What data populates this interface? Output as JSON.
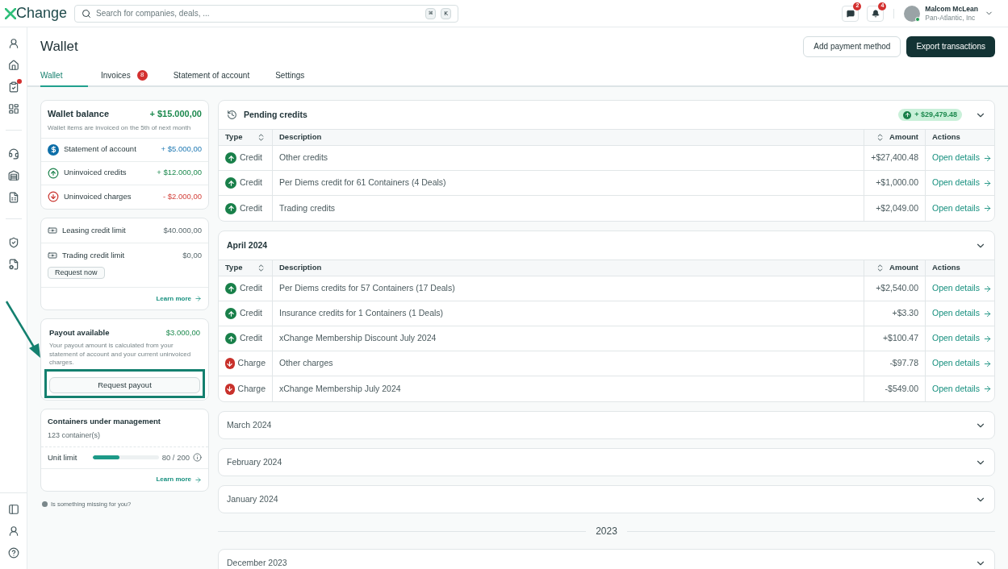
{
  "topbar": {
    "logo": "Change",
    "search": {
      "placeholder": "Search for companies, deals, ...",
      "keys": [
        "⌘",
        "K"
      ]
    },
    "messages_count": "2",
    "notifications_count": "4",
    "user": {
      "name": "Malcom McLean",
      "company": "Pan-Atlantic, Inc",
      "online": true
    }
  },
  "sidebar": {
    "groups": [
      [
        {
          "dot": false
        },
        {
          "dot": false
        },
        {
          "dot": true
        },
        {
          "dot": false
        }
      ],
      [
        {
          "dot": false
        },
        {
          "dot": false
        },
        {
          "dot": false
        }
      ],
      [
        {
          "dot": false
        },
        {
          "dot": false
        }
      ]
    ],
    "bottom": [
      {
        "dot": false
      },
      {
        "dot": false
      },
      {
        "dot": false
      }
    ]
  },
  "page": {
    "title": "Wallet",
    "actions": [
      {
        "label": "Add payment method",
        "primary": false
      },
      {
        "label": "Export transactions",
        "primary": true
      }
    ]
  },
  "tabs": [
    {
      "label": "Wallet",
      "selected": true
    },
    {
      "label": "Invoices",
      "selected": false,
      "badge": "8"
    },
    {
      "label": "Statement of account",
      "selected": false
    },
    {
      "label": "Settings",
      "selected": false
    }
  ],
  "balance": {
    "title": "Wallet balance",
    "total": "+ $15.000,00",
    "note": "Wallet items are invoiced on the 5th of next month",
    "rows": [
      {
        "kind": "statement",
        "label": "Statement of account",
        "value": "+ $5.000,00"
      },
      {
        "kind": "credit",
        "label": "Uninvoiced credits",
        "value": "+ $12.000,00"
      },
      {
        "kind": "charge",
        "label": "Uninvoiced charges",
        "value": "- $2.000,00"
      }
    ]
  },
  "limits": {
    "rows": [
      {
        "label": "Leasing credit limit",
        "value": "$40.000,00"
      },
      {
        "label": "Trading credit limit",
        "value": "$0,00",
        "button": "Request now"
      }
    ],
    "link": "Learn more"
  },
  "payout": {
    "title": "Payout available",
    "amount": "$3.000,00",
    "note": "Your payout amount is calculated from your statement of account and your current uninvoiced charges.",
    "button": "Request payout",
    "highlighted": true
  },
  "containers": {
    "title": "Containers under management",
    "count": "123 container(s)",
    "limit_label": "Unit limit",
    "level": 0.4,
    "reading": "80 / 200",
    "link": "Learn more"
  },
  "help": "Is something missing for you?",
  "sections": [
    {
      "kind": "pending",
      "title": "Pending credits",
      "total": "+ $29,479.48",
      "expanded": true,
      "columns": [
        {
          "label": "Type",
          "sortable": true
        },
        {
          "label": "Description",
          "sortable": false
        },
        {
          "label": "Amount",
          "sortable": true
        },
        {
          "label": "Actions",
          "sortable": false
        }
      ],
      "rows": [
        {
          "kind": "credit",
          "type": "Credit",
          "description": "Other credits",
          "amount": "+$27,400.48",
          "action": "Open details"
        },
        {
          "kind": "credit",
          "type": "Credit",
          "description": "Per Diems credit for 61 Containers (4 Deals)",
          "amount": "+$1,000.00",
          "action": "Open details"
        },
        {
          "kind": "credit",
          "type": "Credit",
          "description": "Trading credits",
          "amount": "+$2,049.00",
          "action": "Open details"
        }
      ]
    },
    {
      "kind": "month",
      "title": "April 2024",
      "expanded": true,
      "columns": [
        {
          "label": "Type",
          "sortable": true
        },
        {
          "label": "Description",
          "sortable": false
        },
        {
          "label": "Amount",
          "sortable": true
        },
        {
          "label": "Actions",
          "sortable": false
        }
      ],
      "rows": [
        {
          "kind": "credit",
          "type": "Credit",
          "description": "Per Diems credits for 57 Containers (17 Deals)",
          "amount": "+$2,540.00",
          "action": "Open details"
        },
        {
          "kind": "credit",
          "type": "Credit",
          "description": "Insurance credits for 1 Containers (1 Deals)",
          "amount": "+$3.30",
          "action": "Open details"
        },
        {
          "kind": "credit",
          "type": "Credit",
          "description": "xChange Membership Discount July 2024",
          "amount": "+$100.47",
          "action": "Open details"
        },
        {
          "kind": "charge",
          "type": "Charge",
          "description": "Other charges",
          "amount": "-$97.78",
          "action": "Open details"
        },
        {
          "kind": "charge",
          "type": "Charge",
          "description": "xChange Membership July 2024",
          "amount": "-$549.00",
          "action": "Open details"
        }
      ]
    },
    {
      "kind": "month",
      "title": "March 2024",
      "expanded": false
    },
    {
      "kind": "month",
      "title": "February 2024",
      "expanded": false
    },
    {
      "kind": "month",
      "title": "January 2024",
      "expanded": false
    },
    {
      "kind": "year",
      "title": "2023"
    },
    {
      "kind": "month",
      "title": "December 2023",
      "expanded": false
    }
  ]
}
